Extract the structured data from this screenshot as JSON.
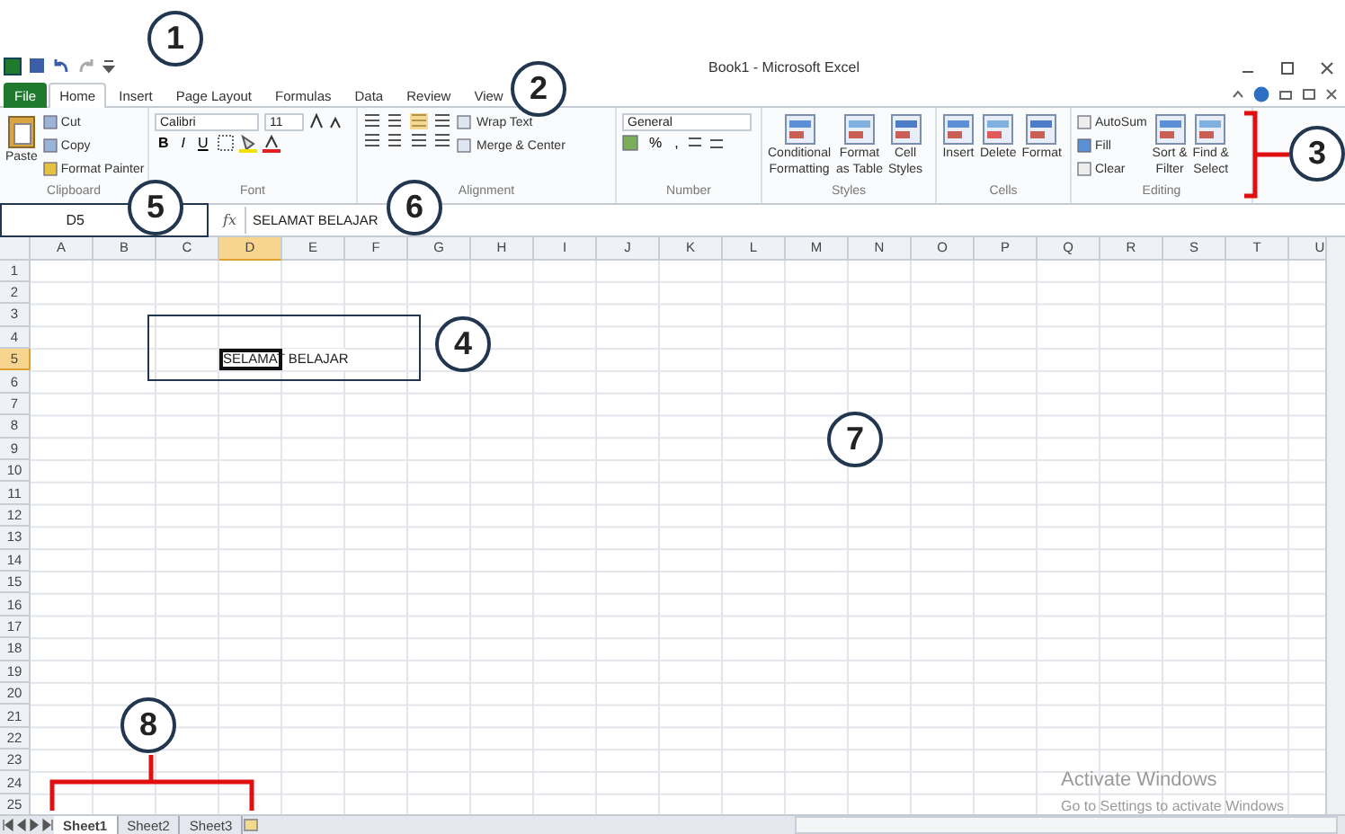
{
  "window": {
    "title": "Book1  -  Microsoft Excel"
  },
  "tabs": [
    {
      "label": "File",
      "kind": "file",
      "selected": false
    },
    {
      "label": "Home",
      "kind": "tab",
      "selected": true
    },
    {
      "label": "Insert",
      "kind": "tab",
      "selected": false
    },
    {
      "label": "Page Layout",
      "kind": "tab",
      "selected": false
    },
    {
      "label": "Formulas",
      "kind": "tab",
      "selected": false
    },
    {
      "label": "Data",
      "kind": "tab",
      "selected": false
    },
    {
      "label": "Review",
      "kind": "tab",
      "selected": false
    },
    {
      "label": "View",
      "kind": "tab",
      "selected": false
    }
  ],
  "ribbon_groups": [
    {
      "kind": "clipboard",
      "label": "Clipboard",
      "big": "Paste",
      "small": [
        "Cut",
        "Copy",
        "Format Painter"
      ]
    },
    {
      "kind": "font",
      "label": "Font",
      "font_name": "Calibri",
      "font_size": "11",
      "styles": [
        "B",
        "I",
        "U"
      ]
    },
    {
      "kind": "alignment",
      "label": "Alignment",
      "wrap": "Wrap Text",
      "merge": "Merge & Center"
    },
    {
      "kind": "number",
      "label": "Number",
      "format": "General",
      "symbols": [
        "%",
        ","
      ]
    },
    {
      "kind": "big",
      "label": "Styles",
      "buttons": [
        {
          "lines": [
            "Conditional",
            "Formatting"
          ]
        },
        {
          "lines": [
            "Format",
            "as Table"
          ]
        },
        {
          "lines": [
            "Cell",
            "Styles"
          ]
        }
      ]
    },
    {
      "kind": "big",
      "label": "Cells",
      "buttons": [
        {
          "lines": [
            "Insert"
          ]
        },
        {
          "lines": [
            "Delete"
          ]
        },
        {
          "lines": [
            "Format"
          ]
        }
      ]
    },
    {
      "kind": "editing",
      "label": "Editing",
      "small": [
        "AutoSum",
        "Fill",
        "Clear"
      ],
      "buttons": [
        {
          "lines": [
            "Sort &",
            "Filter"
          ]
        },
        {
          "lines": [
            "Find &",
            "Select"
          ]
        }
      ]
    }
  ],
  "formula_bar": {
    "name_box": "D5",
    "function_symbol": "fx",
    "formula": "SELAMAT BELAJAR"
  },
  "grid": {
    "columns": [
      {
        "label": "A",
        "selected": false
      },
      {
        "label": "B",
        "selected": false
      },
      {
        "label": "C",
        "selected": false
      },
      {
        "label": "D",
        "selected": true
      },
      {
        "label": "E",
        "selected": false
      },
      {
        "label": "F",
        "selected": false
      },
      {
        "label": "G",
        "selected": false
      },
      {
        "label": "H",
        "selected": false
      },
      {
        "label": "I",
        "selected": false
      },
      {
        "label": "J",
        "selected": false
      },
      {
        "label": "K",
        "selected": false
      },
      {
        "label": "L",
        "selected": false
      },
      {
        "label": "M",
        "selected": false
      },
      {
        "label": "N",
        "selected": false
      },
      {
        "label": "O",
        "selected": false
      },
      {
        "label": "P",
        "selected": false
      },
      {
        "label": "Q",
        "selected": false
      },
      {
        "label": "R",
        "selected": false
      },
      {
        "label": "S",
        "selected": false
      },
      {
        "label": "T",
        "selected": false
      },
      {
        "label": "U",
        "selected": false
      }
    ],
    "rows": [
      {
        "label": "1",
        "selected": false
      },
      {
        "label": "2",
        "selected": false
      },
      {
        "label": "3",
        "selected": false
      },
      {
        "label": "4",
        "selected": false
      },
      {
        "label": "5",
        "selected": true
      },
      {
        "label": "6",
        "selected": false
      },
      {
        "label": "7",
        "selected": false
      },
      {
        "label": "8",
        "selected": false
      },
      {
        "label": "9",
        "selected": false
      },
      {
        "label": "10",
        "selected": false
      },
      {
        "label": "11",
        "selected": false
      },
      {
        "label": "12",
        "selected": false
      },
      {
        "label": "13",
        "selected": false
      },
      {
        "label": "14",
        "selected": false
      },
      {
        "label": "15",
        "selected": false
      },
      {
        "label": "16",
        "selected": false
      },
      {
        "label": "17",
        "selected": false
      },
      {
        "label": "18",
        "selected": false
      },
      {
        "label": "19",
        "selected": false
      },
      {
        "label": "20",
        "selected": false
      },
      {
        "label": "21",
        "selected": false
      },
      {
        "label": "22",
        "selected": false
      },
      {
        "label": "23",
        "selected": false
      },
      {
        "label": "24",
        "selected": false
      },
      {
        "label": "25",
        "selected": false
      }
    ],
    "active_cell_text": "SELAMAT BELAJAR"
  },
  "sheet_tabs": [
    {
      "label": "Sheet1",
      "selected": true
    },
    {
      "label": "Sheet2",
      "selected": false
    },
    {
      "label": "Sheet3",
      "selected": false
    }
  ],
  "activation_notice": {
    "title": "Activate Windows",
    "subtitle": "Go to Settings to activate Windows"
  },
  "annotations": [
    "1",
    "2",
    "3",
    "4",
    "5",
    "6",
    "7",
    "8"
  ]
}
